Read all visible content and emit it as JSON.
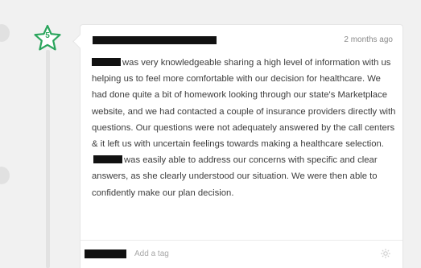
{
  "review": {
    "rating": "5",
    "time_ago": "2 months ago",
    "body_part1": "was very knowledgeable sharing a high level of information with us helping us to feel more comfortable with our decision for healthcare. We had done quite a bit of homework looking through our state's Marketplace website, and we had contacted a couple of insurance providers directly with questions. Our questions were not adequately answered by the call centers & it left us with uncertain feelings towards making a healthcare selection.",
    "body_part2": "was easily able to address our concerns with specific and clear answers, as she clearly understood our situation. We were then able to confidently make our plan decision."
  },
  "footer": {
    "tag_placeholder": "Add a tag"
  },
  "icons": {
    "rating": "star-icon",
    "settings": "gear-icon"
  },
  "colors": {
    "star_green": "#2aa55c",
    "redaction": "#111111"
  }
}
